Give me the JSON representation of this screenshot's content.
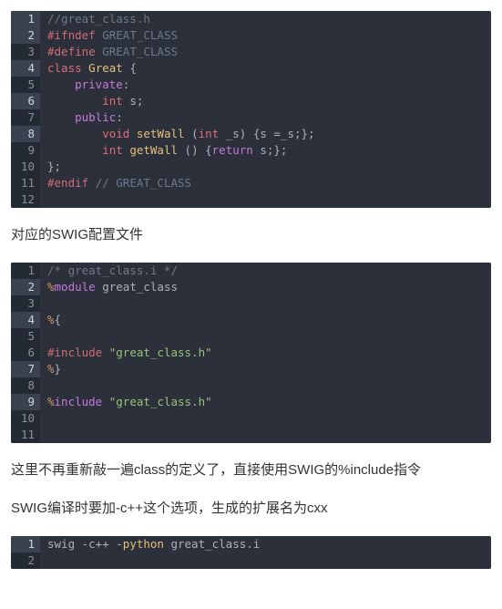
{
  "code1": {
    "lines": [
      [
        [
          "cmt",
          "//great_class.h"
        ]
      ],
      [
        [
          "pp",
          "#ifndef"
        ],
        [
          "op",
          " "
        ],
        [
          "cmt",
          "GREAT_CLASS"
        ]
      ],
      [
        [
          "pp",
          "#define"
        ],
        [
          "op",
          " "
        ],
        [
          "cmt",
          "GREAT_CLASS"
        ]
      ],
      [
        [
          "kw",
          "class"
        ],
        [
          "op",
          " "
        ],
        [
          "ty",
          "Great"
        ],
        [
          "op",
          " {"
        ]
      ],
      [
        [
          "op",
          "    "
        ],
        [
          "kw2",
          "private"
        ],
        [
          "op",
          ":"
        ]
      ],
      [
        [
          "op",
          "        "
        ],
        [
          "kw",
          "int"
        ],
        [
          "op",
          " s;"
        ]
      ],
      [
        [
          "op",
          "    "
        ],
        [
          "kw2",
          "public"
        ],
        [
          "op",
          ":"
        ]
      ],
      [
        [
          "op",
          "        "
        ],
        [
          "kw",
          "void"
        ],
        [
          "op",
          " "
        ],
        [
          "fn",
          "setWall"
        ],
        [
          "op",
          " ("
        ],
        [
          "kw",
          "int"
        ],
        [
          "op",
          " _s) {s =_s;};"
        ]
      ],
      [
        [
          "op",
          "        "
        ],
        [
          "kw",
          "int"
        ],
        [
          "op",
          " "
        ],
        [
          "fn",
          "getWall"
        ],
        [
          "op",
          " () {"
        ],
        [
          "kw2",
          "return"
        ],
        [
          "op",
          " s;};"
        ]
      ],
      [
        [
          "op",
          "};"
        ]
      ],
      [
        [
          "pp",
          "#endif"
        ],
        [
          "op",
          " "
        ],
        [
          "cmt",
          "// GREAT_CLASS"
        ]
      ],
      []
    ],
    "highlight": [
      1,
      2,
      4,
      6,
      8
    ]
  },
  "para1": "对应的SWIG配置文件",
  "code2": {
    "lines": [
      [
        [
          "cmt",
          "/* great_class.i */"
        ]
      ],
      [
        [
          "pct",
          "%"
        ],
        [
          "kw2",
          "module"
        ],
        [
          "op",
          " great_class"
        ]
      ],
      [],
      [
        [
          "pct",
          "%"
        ],
        [
          "op",
          "{"
        ]
      ],
      [],
      [
        [
          "pp",
          "#include"
        ],
        [
          "op",
          " "
        ],
        [
          "str",
          "\"great_class.h\""
        ]
      ],
      [
        [
          "pct",
          "%"
        ],
        [
          "op",
          "}"
        ]
      ],
      [],
      [
        [
          "pct",
          "%"
        ],
        [
          "kw2",
          "include"
        ],
        [
          "op",
          " "
        ],
        [
          "str",
          "\"great_class.h\""
        ]
      ],
      [],
      []
    ],
    "highlight": [
      2,
      4,
      7,
      9
    ]
  },
  "para2": "这里不再重新敲一遍class的定义了，直接使用SWIG的%include指令",
  "para3": "SWIG编译时要加-c++这个选项，生成的扩展名为cxx",
  "code3": {
    "lines": [
      [
        [
          "op",
          "swig -c++ -"
        ],
        [
          "fn",
          "python"
        ],
        [
          "op",
          " great_class.i"
        ]
      ],
      []
    ],
    "highlight": [
      1
    ]
  }
}
